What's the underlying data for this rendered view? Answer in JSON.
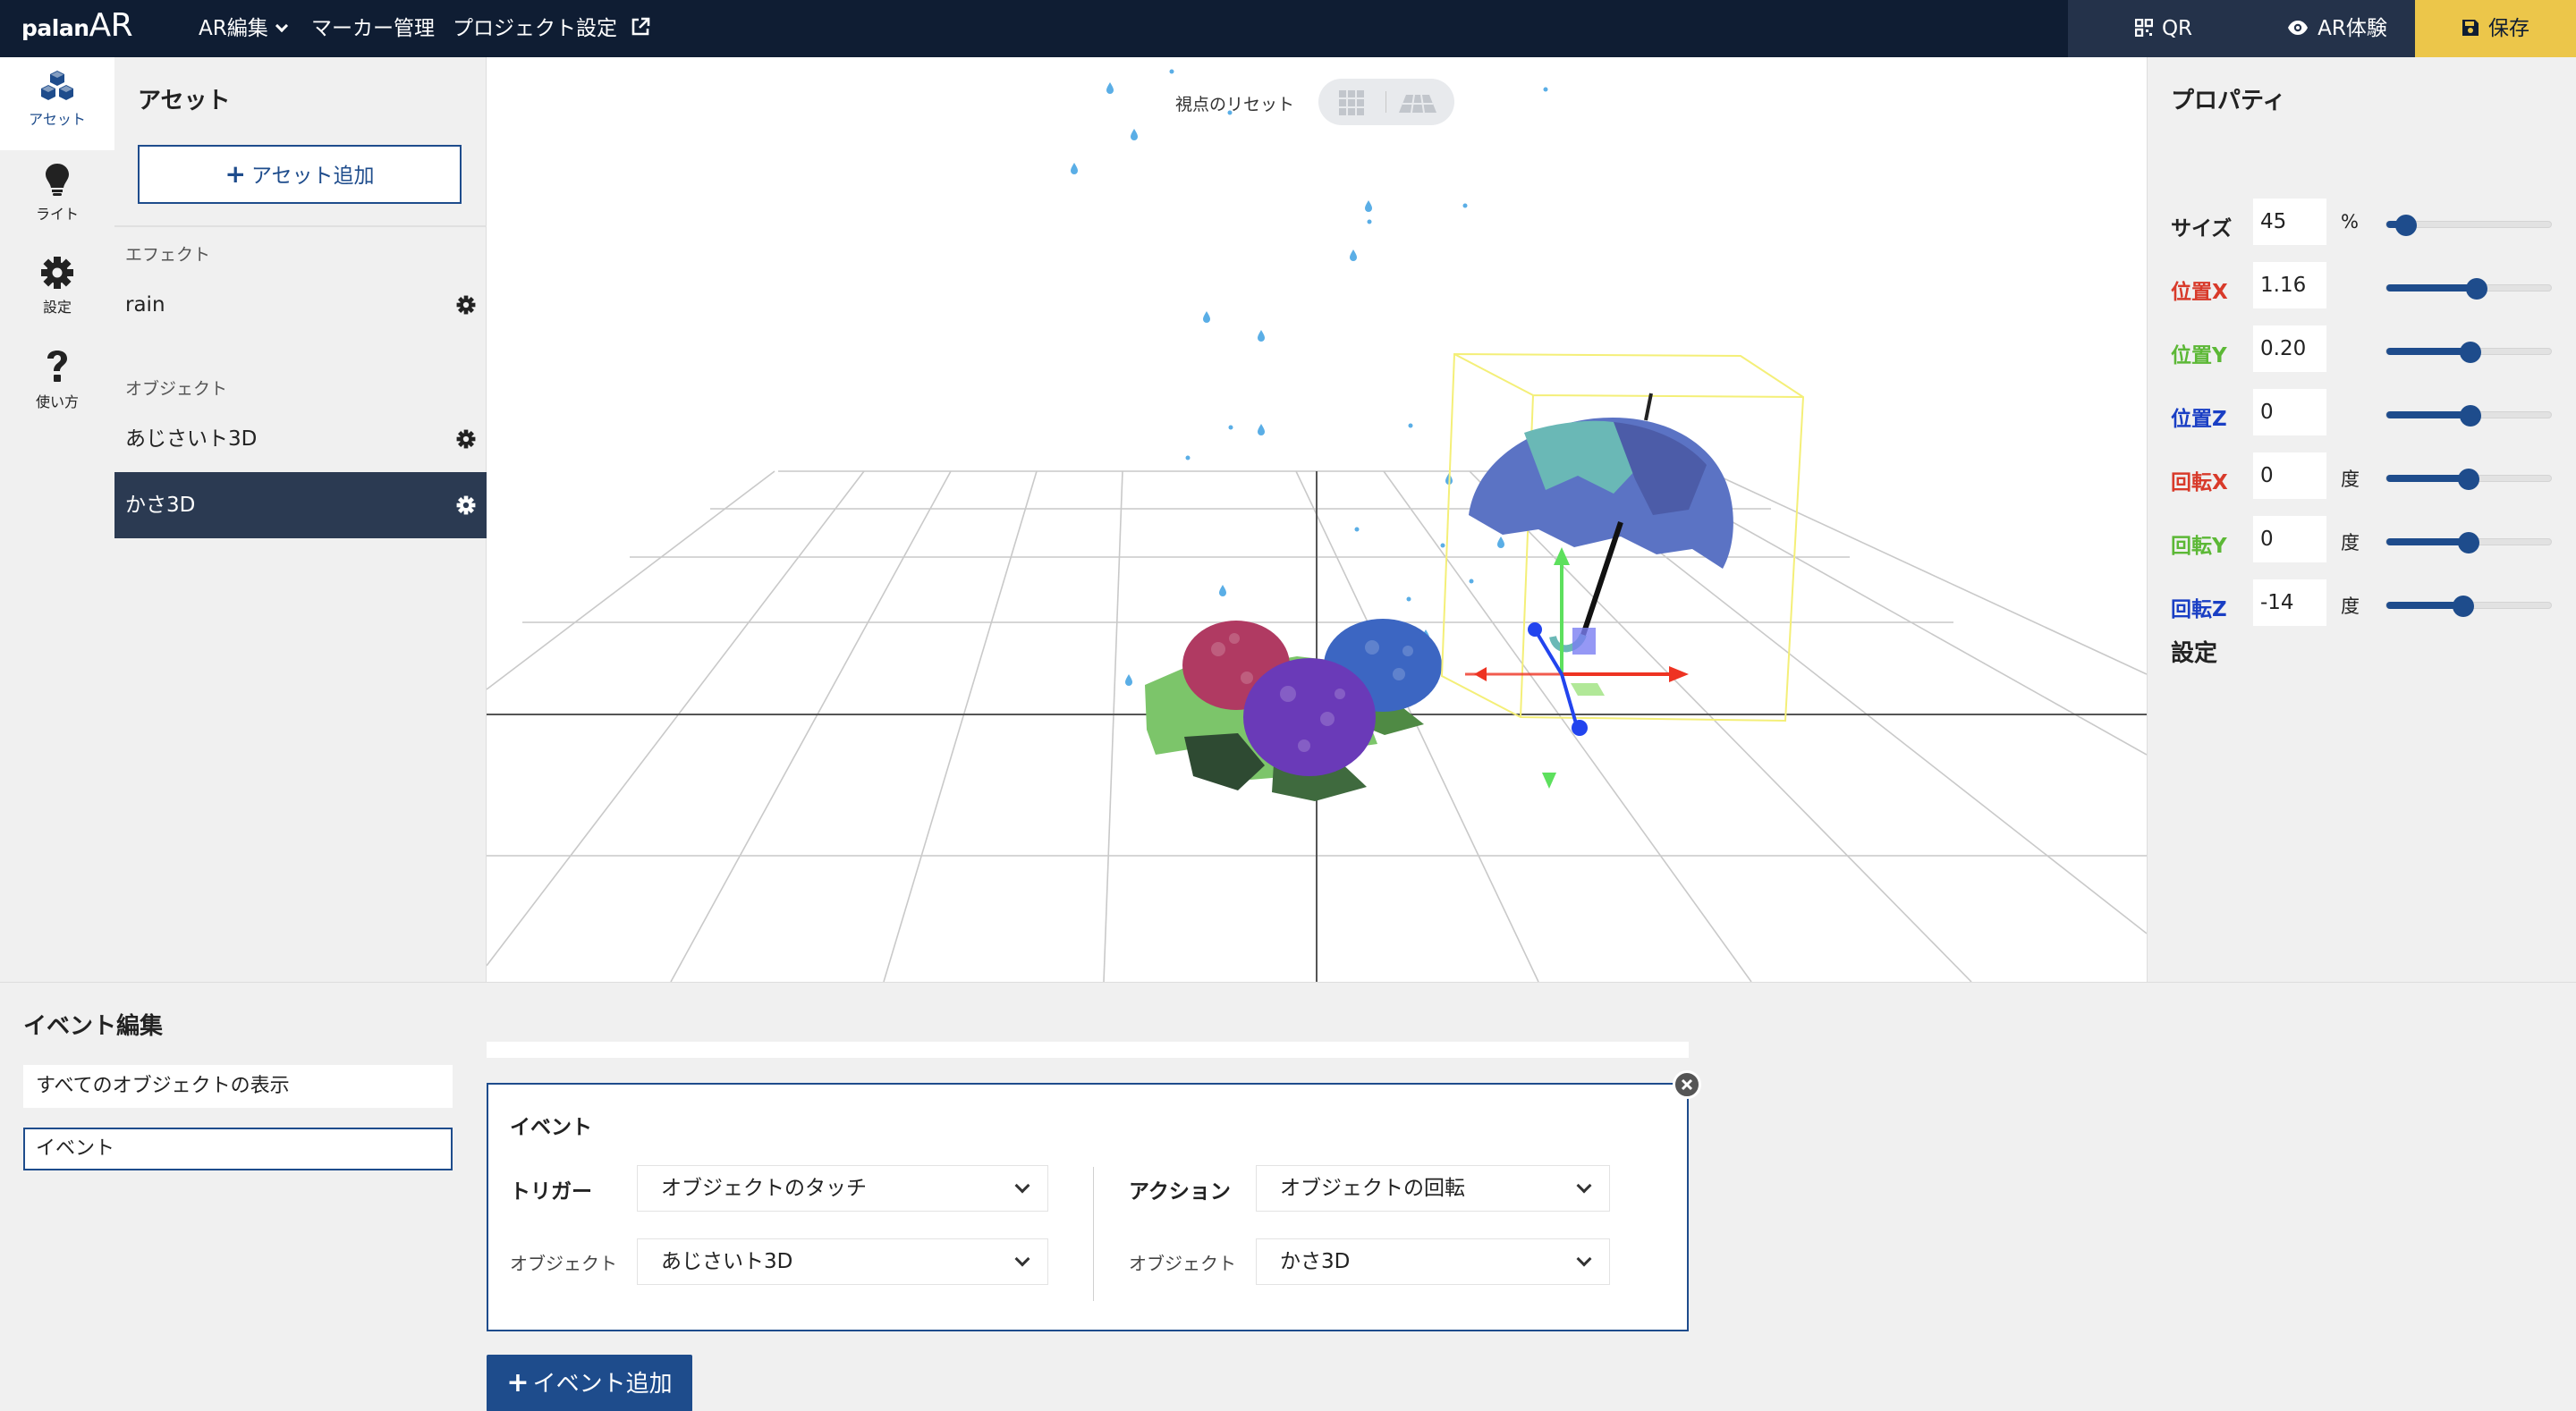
{
  "brand": {
    "logo_small": "palan",
    "logo_big": "AR"
  },
  "nav": {
    "ar_edit": "AR編集",
    "marker": "マーカー管理",
    "project": "プロジェクト設定"
  },
  "toolbar": {
    "qr": "QR",
    "ar_view": "AR体験",
    "save": "保存"
  },
  "rail": [
    {
      "label": "アセット",
      "icon": "cubes-icon",
      "active": true
    },
    {
      "label": "ライト",
      "icon": "lightbulb-icon"
    },
    {
      "label": "設定",
      "icon": "gear-icon"
    },
    {
      "label": "使い方",
      "icon": "question-icon"
    }
  ],
  "assets": {
    "title": "アセット",
    "add_label": "アセット追加",
    "effects_label": "エフェクト",
    "effects": [
      {
        "name": "rain"
      }
    ],
    "objects_label": "オブジェクト",
    "objects": [
      {
        "name": "あじさいト3D"
      },
      {
        "name": "かさ3D",
        "selected": true
      }
    ]
  },
  "viewport": {
    "reset_label": "視点のリセット"
  },
  "properties": {
    "title": "プロパティ",
    "rows": [
      {
        "label": "サイズ",
        "value": "45",
        "unit": "%",
        "slider": 0.12,
        "color": "#222222"
      },
      {
        "label": "位置X",
        "value": "1.16",
        "unit": "",
        "slider": 0.55,
        "color": "#d83a2a"
      },
      {
        "label": "位置Y",
        "value": "0.20",
        "unit": "",
        "slider": 0.51,
        "color": "#5cb836"
      },
      {
        "label": "位置Z",
        "value": "0",
        "unit": "",
        "slider": 0.51,
        "color": "#1a3fc4"
      },
      {
        "label": "回転X",
        "value": "0",
        "unit": "度",
        "slider": 0.5,
        "color": "#d83a2a"
      },
      {
        "label": "回転Y",
        "value": "0",
        "unit": "度",
        "slider": 0.5,
        "color": "#5cb836"
      },
      {
        "label": "回転Z",
        "value": "-14",
        "unit": "度",
        "slider": 0.47,
        "color": "#1a3fc4"
      }
    ],
    "settings_title": "設定"
  },
  "events": {
    "title": "イベント編集",
    "list": [
      {
        "label": "すべてのオブジェクトの表示"
      },
      {
        "label": "イベント",
        "active": true
      }
    ],
    "card": {
      "title": "イベント",
      "trigger_label": "トリガー",
      "trigger_value": "オブジェクトのタッチ",
      "trigger_object_label": "オブジェクト",
      "trigger_object_value": "あじさいト3D",
      "action_label": "アクション",
      "action_value": "オブジェクトの回転",
      "action_object_label": "オブジェクト",
      "action_object_value": "かさ3D"
    },
    "add_label": "イベント追加"
  },
  "colors": {
    "navy": "#0f1d33",
    "accent": "#1e4c8c",
    "save_yellow": "#ecc64a"
  }
}
